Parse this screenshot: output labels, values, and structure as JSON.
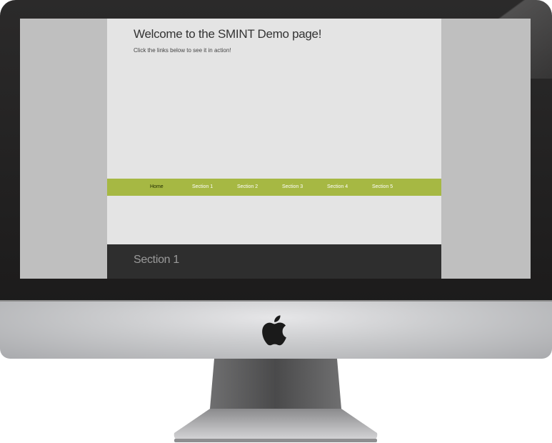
{
  "page": {
    "welcome_title": "Welcome to the SMINT Demo page!",
    "welcome_subtitle": "Click the links below to see it in action!"
  },
  "nav": {
    "items": [
      {
        "label": "Home",
        "active": true
      },
      {
        "label": "Section 1",
        "active": false
      },
      {
        "label": "Section 2",
        "active": false
      },
      {
        "label": "Section 3",
        "active": false
      },
      {
        "label": "Section 4",
        "active": false
      },
      {
        "label": "Section 5",
        "active": false
      }
    ]
  },
  "section": {
    "title": "Section 1"
  },
  "colors": {
    "nav_bar": "#a6b843",
    "page_background": "#e4e4e4",
    "section_band": "#2e2e2e",
    "screen_side": "#bfbfbf",
    "bezel": "#1f1e1e"
  },
  "icons": {
    "logo": "apple-logo-icon"
  }
}
